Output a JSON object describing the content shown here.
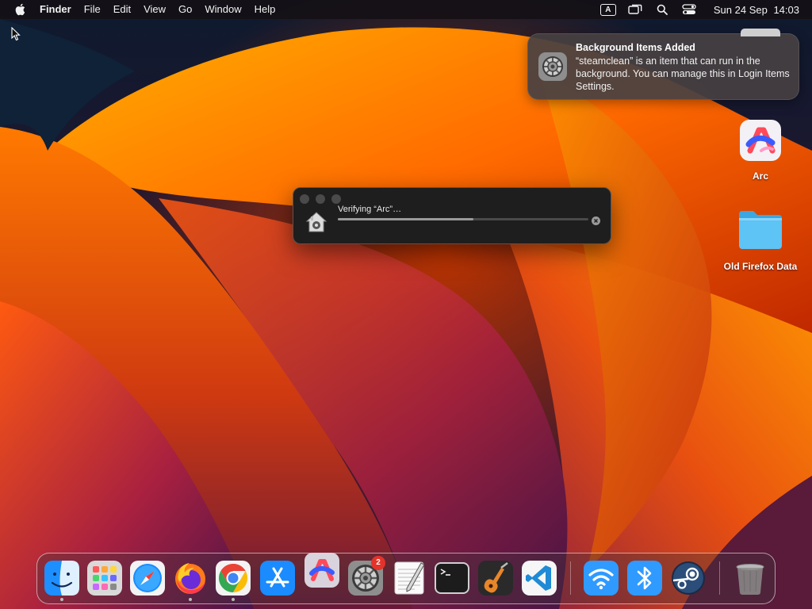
{
  "menubar": {
    "app_name": "Finder",
    "menus": [
      "File",
      "Edit",
      "View",
      "Go",
      "Window",
      "Help"
    ],
    "input_source": "A",
    "clock_date": "Sun 24 Sep",
    "clock_time": "14:03"
  },
  "notification": {
    "title": "Background Items Added",
    "body": "“steamclean” is an item that can run in the background. You can manage this in Login Items Settings.",
    "icon": "system-settings-gear-icon"
  },
  "desktop": {
    "icons": [
      {
        "label": "Arc",
        "icon": "arc-browser-icon"
      },
      {
        "label": "Old Firefox Data",
        "icon": "folder-icon"
      }
    ]
  },
  "verify_dialog": {
    "label": "Verifying “Arc”…",
    "progress": 0.54
  },
  "dock": {
    "items": [
      {
        "name": "Finder",
        "icon": "finder-icon",
        "running": true
      },
      {
        "name": "Launchpad",
        "icon": "launchpad-icon",
        "running": false
      },
      {
        "name": "Safari",
        "icon": "safari-icon",
        "running": false
      },
      {
        "name": "Firefox",
        "icon": "firefox-icon",
        "running": true
      },
      {
        "name": "Chrome",
        "icon": "chrome-icon",
        "running": true
      },
      {
        "name": "App Store",
        "icon": "app-store-icon",
        "running": false
      },
      {
        "name": "Arc",
        "icon": "arc-icon",
        "running": false
      },
      {
        "name": "System Settings",
        "icon": "system-settings-icon",
        "running": false,
        "badge": "2"
      },
      {
        "name": "TextEdit",
        "icon": "textedit-icon",
        "running": false
      },
      {
        "name": "Terminal",
        "icon": "terminal-icon",
        "running": false
      },
      {
        "name": "GarageBand",
        "icon": "garageband-icon",
        "running": false
      },
      {
        "name": "Visual Studio Code",
        "icon": "vscode-icon",
        "running": false
      },
      {
        "name": "Wi-Fi",
        "icon": "wifi-icon",
        "running": false
      },
      {
        "name": "Bluetooth",
        "icon": "bluetooth-icon",
        "running": false
      },
      {
        "name": "Steam",
        "icon": "steam-icon",
        "running": false
      },
      {
        "name": "Trash",
        "icon": "trash-icon",
        "running": false
      }
    ]
  },
  "colors": {
    "menubar_bg": "#141014",
    "notification_bg": "#46403f",
    "dialog_bg": "#1e1e1e",
    "badge": "#e5332a"
  }
}
